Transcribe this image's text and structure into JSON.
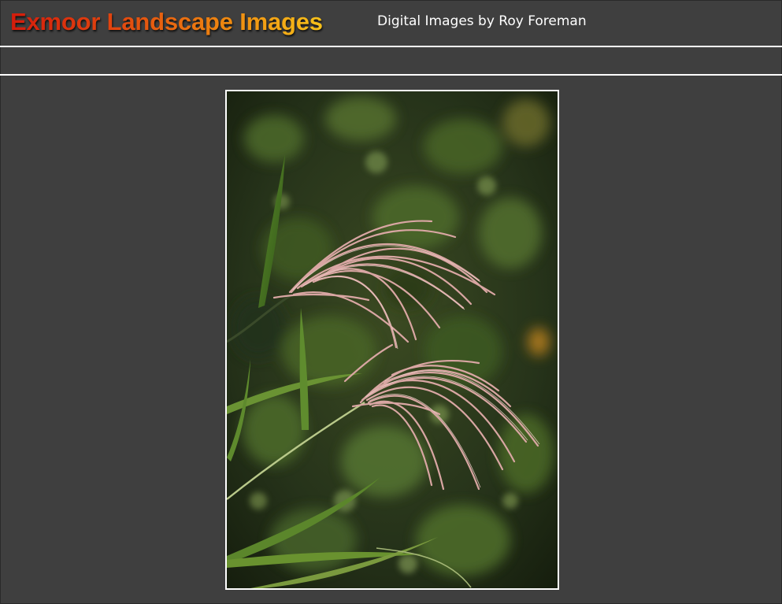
{
  "header": {
    "title": "Exmoor Landscape Images",
    "subtitle": "Digital Images by Roy Foreman"
  },
  "photo": {
    "subject-icon": "grass-seedhead-photo",
    "colors": {
      "background": "#3f3f3f",
      "rule": "#ffffff",
      "title_gradient_start": "#d41c0c",
      "title_gradient_end": "#f7c21a",
      "foliage_dark": "#1f2a12",
      "plume": "#d9a6a3"
    }
  }
}
